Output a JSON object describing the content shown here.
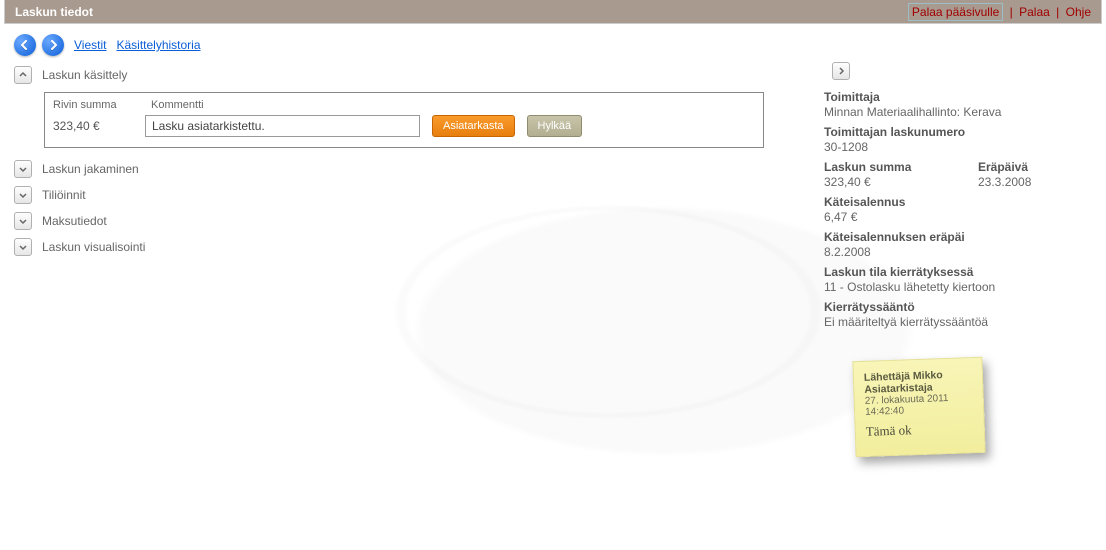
{
  "header": {
    "title": "Laskun tiedot",
    "links": {
      "back_main": "Palaa pääsivulle",
      "back": "Palaa",
      "help": "Ohje"
    }
  },
  "toolbar": {
    "messages": "Viestit",
    "history": "Käsittelyhistoria"
  },
  "sections": {
    "processing": "Laskun käsittely",
    "splitting": "Laskun jakaminen",
    "accounting": "Tiliöinnit",
    "payment": "Maksutiedot",
    "visualization": "Laskun visualisointi"
  },
  "processing": {
    "sum_label": "Rivin summa",
    "comment_label": "Kommentti",
    "sum_value": "323,40 €",
    "comment_value": "Lasku asiatarkistettu.",
    "btn_approve": "Asiatarkasta",
    "btn_reject": "Hylkää"
  },
  "info": {
    "supplier_label": "Toimittaja",
    "supplier_value": "Minnan Materiaalihallinto: Kerava",
    "supplier_invoice_label": "Toimittajan laskunumero",
    "supplier_invoice_value": "30-1208",
    "invoice_sum_label": "Laskun summa",
    "invoice_sum_value": "323,40 €",
    "due_label": "Eräpäivä",
    "due_value": "23.3.2008",
    "cash_discount_label": "Käteisalennus",
    "cash_discount_value": "6,47 €",
    "cash_discount_due_label": "Käteisalennuksen eräpäi",
    "cash_discount_due_value": "8.2.2008",
    "status_label": "Laskun tila kierrätyksessä",
    "status_value": "11 - Ostolasku lähetetty kiertoon",
    "rule_label": "Kierrätyssääntö",
    "rule_value": "Ei määriteltyä kierrätyssääntöä"
  },
  "sticky": {
    "sender": "Lähettäjä Mikko Asiatarkistaja",
    "date": "27. lokakuuta 2011",
    "time": "14:42:40",
    "note": "Tämä ok"
  }
}
